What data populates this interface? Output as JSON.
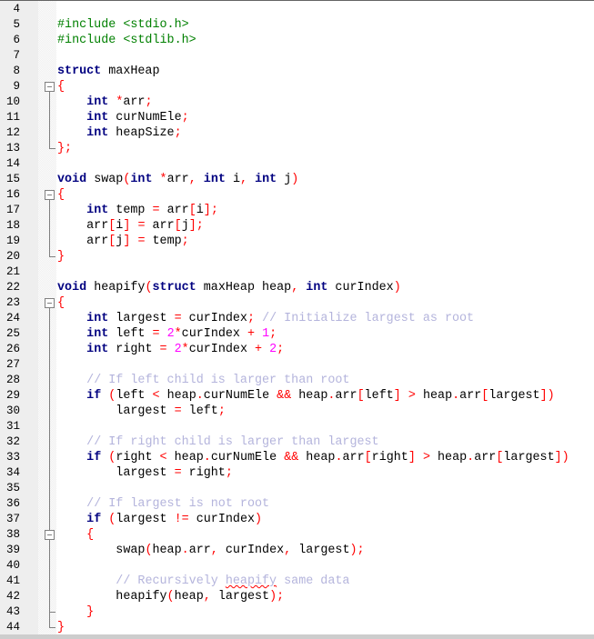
{
  "editor": {
    "language": "C",
    "colors": {
      "preprocessor": "#008000",
      "keyword": "#000080",
      "operator": "#ff0000",
      "number": "#ff00ff",
      "comment": "#b4b4dc",
      "gutter": "#eeeeee"
    },
    "lines": [
      {
        "n": "4",
        "fold": "",
        "tokens": []
      },
      {
        "n": "5",
        "fold": "",
        "tokens": [
          [
            "pre",
            "#include <stdio.h>"
          ]
        ]
      },
      {
        "n": "6",
        "fold": "",
        "tokens": [
          [
            "pre",
            "#include <stdlib.h>"
          ]
        ]
      },
      {
        "n": "7",
        "fold": "",
        "tokens": []
      },
      {
        "n": "8",
        "fold": "",
        "tokens": [
          [
            "kw",
            "struct"
          ],
          [
            "id",
            " maxHeap"
          ]
        ]
      },
      {
        "n": "9",
        "fold": "open",
        "tokens": [
          [
            "op",
            "{"
          ]
        ]
      },
      {
        "n": "10",
        "fold": "line",
        "tokens": [
          [
            "id",
            "    "
          ],
          [
            "kw",
            "int"
          ],
          [
            "id",
            " "
          ],
          [
            "op",
            "*"
          ],
          [
            "id",
            "arr"
          ],
          [
            "op",
            ";"
          ]
        ]
      },
      {
        "n": "11",
        "fold": "line",
        "tokens": [
          [
            "id",
            "    "
          ],
          [
            "kw",
            "int"
          ],
          [
            "id",
            " curNumEle"
          ],
          [
            "op",
            ";"
          ]
        ]
      },
      {
        "n": "12",
        "fold": "line",
        "tokens": [
          [
            "id",
            "    "
          ],
          [
            "kw",
            "int"
          ],
          [
            "id",
            " heapSize"
          ],
          [
            "op",
            ";"
          ]
        ]
      },
      {
        "n": "13",
        "fold": "end",
        "tokens": [
          [
            "op",
            "};"
          ]
        ]
      },
      {
        "n": "14",
        "fold": "",
        "tokens": []
      },
      {
        "n": "15",
        "fold": "",
        "tokens": [
          [
            "kw",
            "void"
          ],
          [
            "id",
            " swap"
          ],
          [
            "op",
            "("
          ],
          [
            "kw",
            "int"
          ],
          [
            "id",
            " "
          ],
          [
            "op",
            "*"
          ],
          [
            "id",
            "arr"
          ],
          [
            "op",
            ","
          ],
          [
            "id",
            " "
          ],
          [
            "kw",
            "int"
          ],
          [
            "id",
            " i"
          ],
          [
            "op",
            ","
          ],
          [
            "id",
            " "
          ],
          [
            "kw",
            "int"
          ],
          [
            "id",
            " j"
          ],
          [
            "op",
            ")"
          ]
        ]
      },
      {
        "n": "16",
        "fold": "open",
        "tokens": [
          [
            "op",
            "{"
          ]
        ]
      },
      {
        "n": "17",
        "fold": "line",
        "tokens": [
          [
            "id",
            "    "
          ],
          [
            "kw",
            "int"
          ],
          [
            "id",
            " temp "
          ],
          [
            "op",
            "="
          ],
          [
            "id",
            " arr"
          ],
          [
            "op",
            "["
          ],
          [
            "id",
            "i"
          ],
          [
            "op",
            "];"
          ]
        ]
      },
      {
        "n": "18",
        "fold": "line",
        "tokens": [
          [
            "id",
            "    arr"
          ],
          [
            "op",
            "["
          ],
          [
            "id",
            "i"
          ],
          [
            "op",
            "]"
          ],
          [
            "id",
            " "
          ],
          [
            "op",
            "="
          ],
          [
            "id",
            " arr"
          ],
          [
            "op",
            "["
          ],
          [
            "id",
            "j"
          ],
          [
            "op",
            "];"
          ]
        ]
      },
      {
        "n": "19",
        "fold": "line",
        "tokens": [
          [
            "id",
            "    arr"
          ],
          [
            "op",
            "["
          ],
          [
            "id",
            "j"
          ],
          [
            "op",
            "]"
          ],
          [
            "id",
            " "
          ],
          [
            "op",
            "="
          ],
          [
            "id",
            " temp"
          ],
          [
            "op",
            ";"
          ]
        ]
      },
      {
        "n": "20",
        "fold": "end",
        "tokens": [
          [
            "op",
            "}"
          ]
        ]
      },
      {
        "n": "21",
        "fold": "",
        "tokens": []
      },
      {
        "n": "22",
        "fold": "",
        "tokens": [
          [
            "kw",
            "void"
          ],
          [
            "id",
            " heapify"
          ],
          [
            "op",
            "("
          ],
          [
            "kw",
            "struct"
          ],
          [
            "id",
            " maxHeap heap"
          ],
          [
            "op",
            ","
          ],
          [
            "id",
            " "
          ],
          [
            "kw",
            "int"
          ],
          [
            "id",
            " curIndex"
          ],
          [
            "op",
            ")"
          ]
        ]
      },
      {
        "n": "23",
        "fold": "open",
        "tokens": [
          [
            "op",
            "{"
          ]
        ]
      },
      {
        "n": "24",
        "fold": "line",
        "tokens": [
          [
            "id",
            "    "
          ],
          [
            "kw",
            "int"
          ],
          [
            "id",
            " largest "
          ],
          [
            "op",
            "="
          ],
          [
            "id",
            " curIndex"
          ],
          [
            "op",
            ";"
          ],
          [
            "id",
            " "
          ],
          [
            "cm",
            "// Initialize largest as root"
          ]
        ]
      },
      {
        "n": "25",
        "fold": "line",
        "tokens": [
          [
            "id",
            "    "
          ],
          [
            "kw",
            "int"
          ],
          [
            "id",
            " left "
          ],
          [
            "op",
            "="
          ],
          [
            "id",
            " "
          ],
          [
            "num",
            "2"
          ],
          [
            "op",
            "*"
          ],
          [
            "id",
            "curIndex "
          ],
          [
            "op",
            "+"
          ],
          [
            "id",
            " "
          ],
          [
            "num",
            "1"
          ],
          [
            "op",
            ";"
          ]
        ]
      },
      {
        "n": "26",
        "fold": "line",
        "tokens": [
          [
            "id",
            "    "
          ],
          [
            "kw",
            "int"
          ],
          [
            "id",
            " right "
          ],
          [
            "op",
            "="
          ],
          [
            "id",
            " "
          ],
          [
            "num",
            "2"
          ],
          [
            "op",
            "*"
          ],
          [
            "id",
            "curIndex "
          ],
          [
            "op",
            "+"
          ],
          [
            "id",
            " "
          ],
          [
            "num",
            "2"
          ],
          [
            "op",
            ";"
          ]
        ]
      },
      {
        "n": "27",
        "fold": "line",
        "tokens": []
      },
      {
        "n": "28",
        "fold": "line",
        "tokens": [
          [
            "id",
            "    "
          ],
          [
            "cm",
            "// If left child is larger than root"
          ]
        ]
      },
      {
        "n": "29",
        "fold": "line",
        "tokens": [
          [
            "id",
            "    "
          ],
          [
            "kw",
            "if"
          ],
          [
            "id",
            " "
          ],
          [
            "op",
            "("
          ],
          [
            "id",
            "left "
          ],
          [
            "op",
            "<"
          ],
          [
            "id",
            " heap"
          ],
          [
            "op",
            "."
          ],
          [
            "id",
            "curNumEle "
          ],
          [
            "op",
            "&&"
          ],
          [
            "id",
            " heap"
          ],
          [
            "op",
            "."
          ],
          [
            "id",
            "arr"
          ],
          [
            "op",
            "["
          ],
          [
            "id",
            "left"
          ],
          [
            "op",
            "]"
          ],
          [
            "id",
            " "
          ],
          [
            "op",
            ">"
          ],
          [
            "id",
            " heap"
          ],
          [
            "op",
            "."
          ],
          [
            "id",
            "arr"
          ],
          [
            "op",
            "["
          ],
          [
            "id",
            "largest"
          ],
          [
            "op",
            "])"
          ]
        ]
      },
      {
        "n": "30",
        "fold": "line",
        "tokens": [
          [
            "id",
            "        largest "
          ],
          [
            "op",
            "="
          ],
          [
            "id",
            " left"
          ],
          [
            "op",
            ";"
          ]
        ]
      },
      {
        "n": "31",
        "fold": "line",
        "tokens": []
      },
      {
        "n": "32",
        "fold": "line",
        "tokens": [
          [
            "id",
            "    "
          ],
          [
            "cm",
            "// If right child is larger than largest"
          ]
        ]
      },
      {
        "n": "33",
        "fold": "line",
        "tokens": [
          [
            "id",
            "    "
          ],
          [
            "kw",
            "if"
          ],
          [
            "id",
            " "
          ],
          [
            "op",
            "("
          ],
          [
            "id",
            "right "
          ],
          [
            "op",
            "<"
          ],
          [
            "id",
            " heap"
          ],
          [
            "op",
            "."
          ],
          [
            "id",
            "curNumEle "
          ],
          [
            "op",
            "&&"
          ],
          [
            "id",
            " heap"
          ],
          [
            "op",
            "."
          ],
          [
            "id",
            "arr"
          ],
          [
            "op",
            "["
          ],
          [
            "id",
            "right"
          ],
          [
            "op",
            "]"
          ],
          [
            "id",
            " "
          ],
          [
            "op",
            ">"
          ],
          [
            "id",
            " heap"
          ],
          [
            "op",
            "."
          ],
          [
            "id",
            "arr"
          ],
          [
            "op",
            "["
          ],
          [
            "id",
            "largest"
          ],
          [
            "op",
            "])"
          ]
        ]
      },
      {
        "n": "34",
        "fold": "line",
        "tokens": [
          [
            "id",
            "        largest "
          ],
          [
            "op",
            "="
          ],
          [
            "id",
            " right"
          ],
          [
            "op",
            ";"
          ]
        ]
      },
      {
        "n": "35",
        "fold": "line",
        "tokens": []
      },
      {
        "n": "36",
        "fold": "line",
        "tokens": [
          [
            "id",
            "    "
          ],
          [
            "cm",
            "// If largest is not root"
          ]
        ]
      },
      {
        "n": "37",
        "fold": "line",
        "tokens": [
          [
            "id",
            "    "
          ],
          [
            "kw",
            "if"
          ],
          [
            "id",
            " "
          ],
          [
            "op",
            "("
          ],
          [
            "id",
            "largest "
          ],
          [
            "op",
            "!="
          ],
          [
            "id",
            " curIndex"
          ],
          [
            "op",
            ")"
          ]
        ]
      },
      {
        "n": "38",
        "fold": "open-inner",
        "tokens": [
          [
            "id",
            "    "
          ],
          [
            "op",
            "{"
          ]
        ]
      },
      {
        "n": "39",
        "fold": "line",
        "tokens": [
          [
            "id",
            "        swap"
          ],
          [
            "op",
            "("
          ],
          [
            "id",
            "heap"
          ],
          [
            "op",
            "."
          ],
          [
            "id",
            "arr"
          ],
          [
            "op",
            ","
          ],
          [
            "id",
            " curIndex"
          ],
          [
            "op",
            ","
          ],
          [
            "id",
            " largest"
          ],
          [
            "op",
            ");"
          ]
        ]
      },
      {
        "n": "40",
        "fold": "line",
        "tokens": []
      },
      {
        "n": "41",
        "fold": "line",
        "tokens": [
          [
            "id",
            "        "
          ],
          [
            "cm",
            "// Recursively "
          ],
          [
            "cm-sp",
            "heapify"
          ],
          [
            "cm",
            " same data"
          ]
        ]
      },
      {
        "n": "42",
        "fold": "line",
        "tokens": [
          [
            "id",
            "        heapify"
          ],
          [
            "op",
            "("
          ],
          [
            "id",
            "heap"
          ],
          [
            "op",
            ","
          ],
          [
            "id",
            " largest"
          ],
          [
            "op",
            ");"
          ]
        ]
      },
      {
        "n": "43",
        "fold": "mid",
        "tokens": [
          [
            "id",
            "    "
          ],
          [
            "op",
            "}"
          ]
        ]
      },
      {
        "n": "44",
        "fold": "end",
        "tokens": [
          [
            "op",
            "}"
          ]
        ]
      }
    ]
  }
}
